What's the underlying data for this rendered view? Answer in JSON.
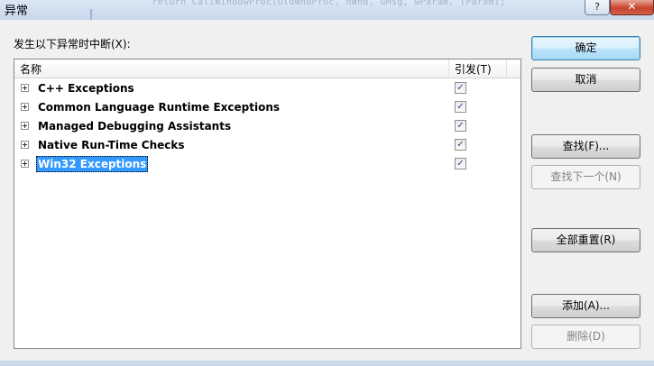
{
  "window": {
    "title": "异常",
    "background_code": "        return CallWindowProc(OldWndProc, hWnd, uMsg, wParam, lParam);",
    "help_glyph": "?",
    "close_glyph": "✕"
  },
  "prompt_label": "发生以下异常时中断(X):",
  "list": {
    "columns": {
      "name": "名称",
      "break": "引发(T)"
    },
    "rows": [
      {
        "label": "C++ Exceptions",
        "checked": true,
        "selected": false
      },
      {
        "label": "Common Language Runtime Exceptions",
        "checked": true,
        "selected": false
      },
      {
        "label": "Managed Debugging Assistants",
        "checked": true,
        "selected": false
      },
      {
        "label": "Native Run-Time Checks",
        "checked": true,
        "selected": false
      },
      {
        "label": "Win32 Exceptions",
        "checked": true,
        "selected": true
      }
    ],
    "check_glyph": "✓"
  },
  "buttons": {
    "ok": "确定",
    "cancel": "取消",
    "find": "查找(F)...",
    "find_next": "查找下一个(N)",
    "reset_all": "全部重置(R)",
    "add": "添加(A)...",
    "delete": "删除(D)"
  },
  "colors": {
    "selection": "#3399ff",
    "close_button": "#c7432d",
    "window_frame": "#c9d9ec"
  }
}
